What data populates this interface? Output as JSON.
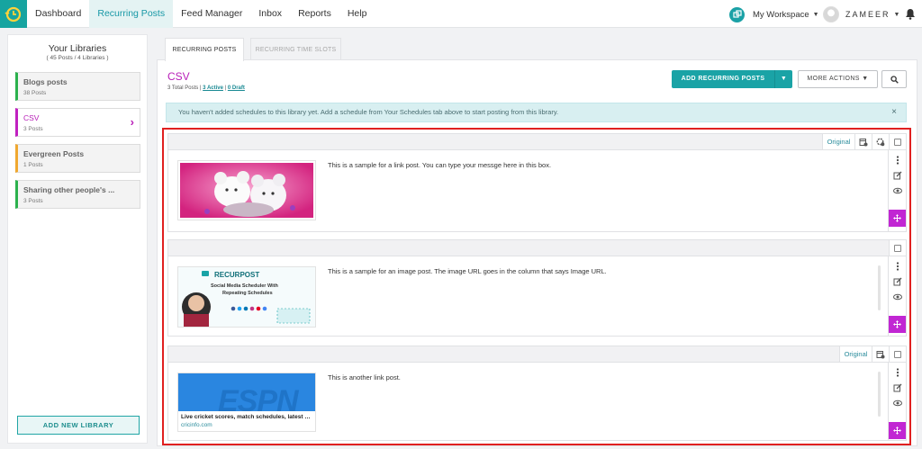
{
  "nav": {
    "items": [
      "Dashboard",
      "Recurring Posts",
      "Feed Manager",
      "Inbox",
      "Reports",
      "Help"
    ],
    "active": 1
  },
  "workspace": {
    "label": "My Workspace"
  },
  "user": {
    "name": "ZAMEER"
  },
  "sidebar": {
    "title": "Your Libraries",
    "subtitle": "( 45 Posts / 4 Libraries )",
    "libraries": [
      {
        "name": "Blogs posts",
        "count": "38 Posts"
      },
      {
        "name": "CSV",
        "count": "3 Posts"
      },
      {
        "name": "Evergreen Posts",
        "count": "1 Posts"
      },
      {
        "name": "Sharing other people's ...",
        "count": "3 Posts"
      }
    ],
    "add_button": "ADD NEW LIBRARY"
  },
  "tabs": {
    "recurring_posts": "RECURRING POSTS",
    "recurring_time_slots": "RECURRING TIME SLOTS"
  },
  "library": {
    "title": "CSV",
    "total": "3 Total Posts",
    "separator": "|",
    "active_link": "3 Active",
    "draft_link": "0 Draft"
  },
  "actions": {
    "add_recurring": "ADD RECURRING POSTS",
    "more_actions": "MORE ACTIONS"
  },
  "notice": {
    "text": "You haven't added schedules to this library yet. Add a schedule from Your Schedules tab above to start posting from this library.",
    "close": "×"
  },
  "posts": [
    {
      "badge": "Original",
      "text": "This is a sample for a link post. You can type your messge here in this box."
    },
    {
      "text": "This is a sample for an image post. The image URL goes in the column that says Image URL."
    },
    {
      "badge": "Original",
      "text": "This is another link post.",
      "link_title": "Live cricket scores, match schedules, latest c...",
      "link_domain": "cricinfo.com"
    }
  ],
  "recurpost_image": {
    "brand": "RECURPOST",
    "headline_1": "Social Media Scheduler With",
    "headline_2": "Repeating Schedules"
  },
  "espn_logo": "ESPN",
  "colors": {
    "teal": "#1aa3a6",
    "magenta": "#c126d3",
    "outline": "#e02020"
  }
}
